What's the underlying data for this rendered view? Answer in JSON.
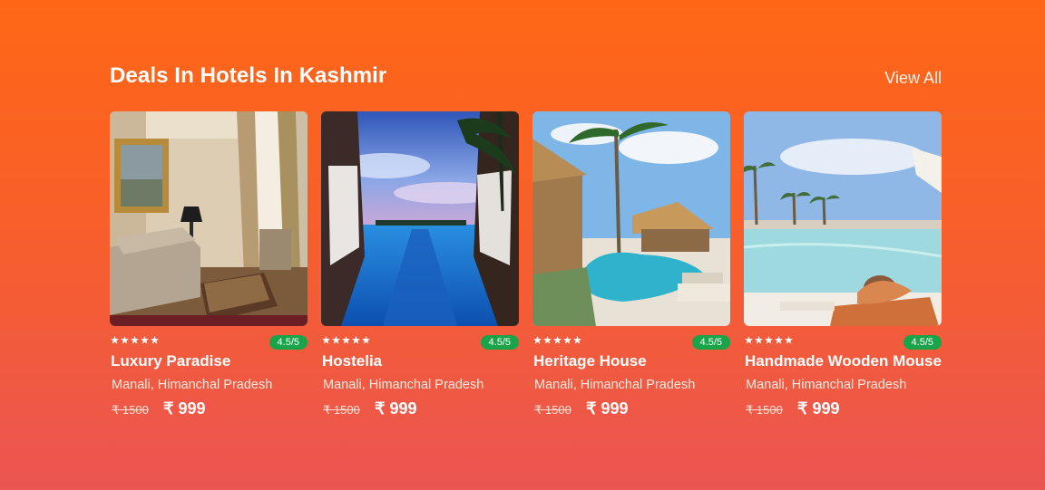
{
  "section": {
    "title": "Deals In Hotels In Kashmir",
    "view_all_label": "View All",
    "background_top": "#ff6716",
    "background_bottom": "#eb5552"
  },
  "rating_badge_color": "#1aa449",
  "hotels": [
    {
      "name": "Luxury Paradise",
      "location": "Manali, Himanchal Pradesh",
      "rating": "4.5/5",
      "stars": 5,
      "old_price": "₹ 1500",
      "price": "₹ 999",
      "image": "luxury-living-room-photo"
    },
    {
      "name": "Hostelia",
      "location": "Manali, Himanchal Pradesh",
      "rating": "4.5/5",
      "stars": 5,
      "old_price": "₹ 1500",
      "price": "₹ 999",
      "image": "infinity-pool-cabanas-photo"
    },
    {
      "name": "Heritage House",
      "location": "Manali, Himanchal Pradesh",
      "rating": "4.5/5",
      "stars": 5,
      "old_price": "₹ 1500",
      "price": "₹ 999",
      "image": "tropical-pool-palms-photo"
    },
    {
      "name": "Handmade Wooden Mouse",
      "location": "Manali, Himanchal Pradesh",
      "rating": "4.5/5",
      "stars": 5,
      "old_price": "₹ 1500",
      "price": "₹ 999",
      "image": "poolside-lounger-photo"
    }
  ]
}
